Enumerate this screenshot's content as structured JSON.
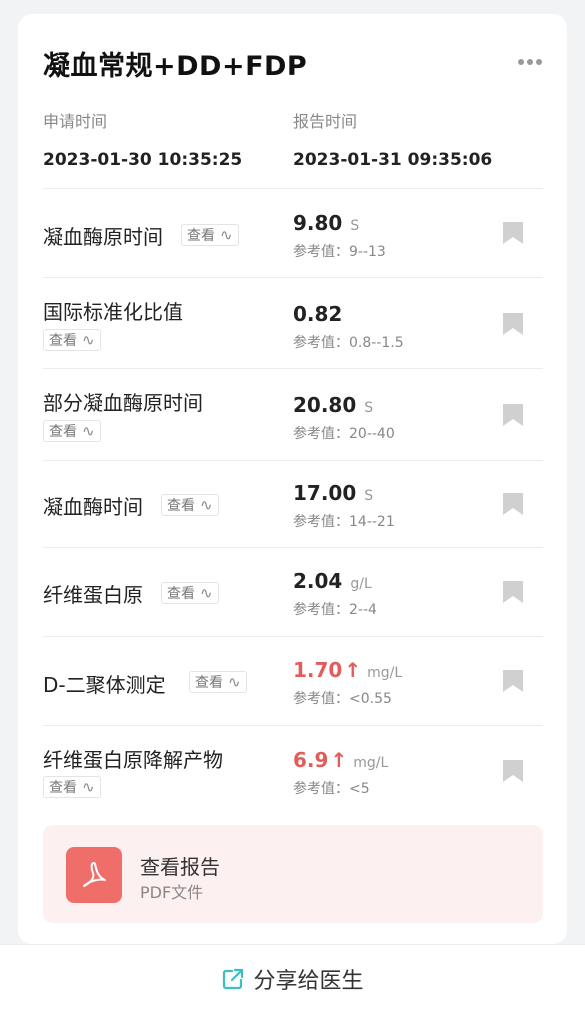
{
  "header": {
    "title": "凝血常规+DD+FDP",
    "apply_label": "申请时间",
    "apply_time": "2023-01-30 10:35:25",
    "report_label": "报告时间",
    "report_time": "2023-01-31 09:35:06"
  },
  "view_label": "查看",
  "items": [
    {
      "name": "凝血酶原时间",
      "value": "9.80",
      "unit": "S",
      "ref": "参考值：9--13",
      "arrow": "",
      "high": false
    },
    {
      "name": "国际标准化比值",
      "value": "0.82",
      "unit": "",
      "ref": "参考值：0.8--1.5",
      "arrow": "",
      "high": false
    },
    {
      "name": "部分凝血酶原时间",
      "value": "20.80",
      "unit": "S",
      "ref": "参考值：20--40",
      "arrow": "",
      "high": false
    },
    {
      "name": "凝血酶时间",
      "value": "17.00",
      "unit": "S",
      "ref": "参考值：14--21",
      "arrow": "",
      "high": false
    },
    {
      "name": "纤维蛋白原",
      "value": "2.04",
      "unit": "g/L",
      "ref": "参考值：2--4",
      "arrow": "",
      "high": false
    },
    {
      "name": "D-二聚体测定",
      "value": "1.70",
      "unit": "mg/L",
      "ref": "参考值：<0.55",
      "arrow": "↑",
      "high": true
    },
    {
      "name": "纤维蛋白原降解产物",
      "value": "6.9",
      "unit": "mg/L",
      "ref": "参考值：<5",
      "arrow": "↑",
      "high": true
    }
  ],
  "report": {
    "title": "查看报告",
    "subtitle": "PDF文件",
    "icon": "pdf-icon"
  },
  "share": {
    "label": "分享给医生",
    "icon": "share-icon"
  },
  "colors": {
    "high": "#e25c5c",
    "pdf_bg": "#f06e6a",
    "share_icon": "#3cbfbf",
    "bookmark": "#d0d0d0"
  }
}
